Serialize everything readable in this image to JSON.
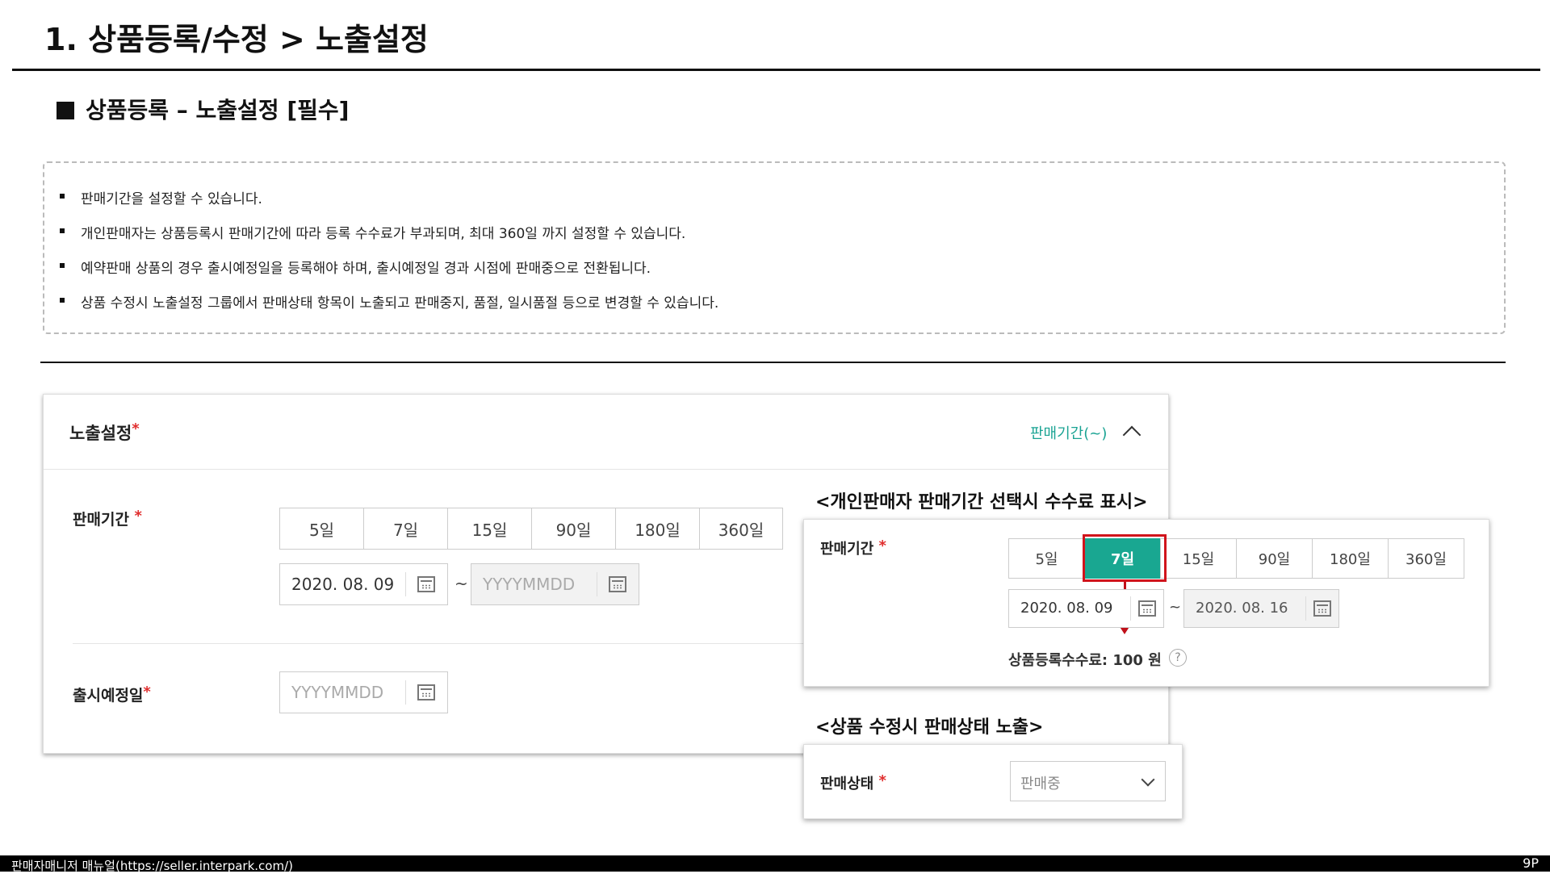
{
  "page_title": "1. 상품등록/수정  >  노출설정",
  "section_title": "상품등록 – 노출설정 [필수]",
  "notices": [
    "판매기간을 설정할 수 있습니다.",
    "개인판매자는 상품등록시 판매기간에 따라 등록 수수료가 부과되며, 최대 360일 까지 설정할 수 있습니다.",
    "예약판매 상품의 경우 출시예정일을 등록해야 하며, 출시예정일 경과 시점에 판매중으로 전환됩니다.",
    "상품 수정시 노출설정 그룹에서 판매상태 항목이 노출되고 판매중지, 품절, 일시품절 등으로 변경할 수 있습니다."
  ],
  "card": {
    "title": "노출설정",
    "required_mark": "*",
    "toggle_label": "판매기간(~)",
    "sale_period_label": "판매기간",
    "period_options": [
      "5일",
      "7일",
      "15일",
      "90일",
      "180일",
      "360일"
    ],
    "start_date": "2020. 08. 09",
    "tilde": "~",
    "end_placeholder": "YYYYMMDD",
    "release_label": "출시예정일",
    "release_placeholder": "YYYYMMDD"
  },
  "overlay1": {
    "title": "<개인판매자 판매기간 선택시 수수료 표시>",
    "sale_period_label": "판매기간",
    "period_options": [
      "5일",
      "7일",
      "15일",
      "90일",
      "180일",
      "360일"
    ],
    "selected_option": "7일",
    "start_date": "2020. 08. 09",
    "tilde": "~",
    "end_date": "2020. 08. 16",
    "fee_text": "상품등록수수료: 100 원",
    "help": "?"
  },
  "overlay2": {
    "title": "<상품 수정시 판매상태 노출>",
    "status_label": "판매상태",
    "status_value": "판매중"
  },
  "footer": {
    "left": "판매자매니저 매뉴얼(https://seller.interpark.com/)",
    "right": "9P"
  },
  "colors": {
    "accent": "#19a791",
    "highlight": "#d0141c",
    "required": "#e02d2d"
  },
  "icons": [
    "calendar-icon",
    "chevron-up-icon",
    "chevron-down-icon",
    "help-icon",
    "arrow-down-icon"
  ]
}
